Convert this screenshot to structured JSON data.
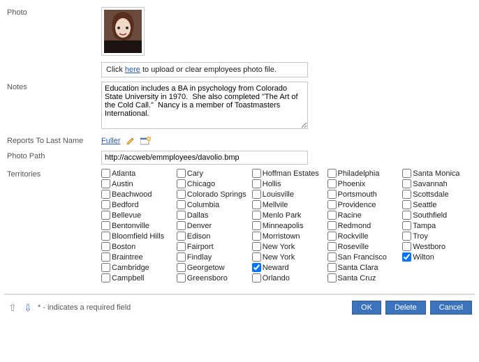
{
  "labels": {
    "photo": "Photo",
    "notes": "Notes",
    "reports_to_last_name": "Reports To Last Name",
    "photo_path": "Photo Path",
    "territories": "Territories"
  },
  "upload_hint": {
    "prefix": "Click ",
    "link": "here",
    "suffix": " to upload or clear employees photo file."
  },
  "notes_value": "Education includes a BA in psychology from Colorado State University in 1970.  She also completed \"The Art of the Cold Call.\"  Nancy is a member of Toastmasters International.",
  "reports_to": {
    "value": "Fuller"
  },
  "photo_path_value": "http://accweb/emmployees/davolio.bmp",
  "territories": [
    {
      "label": "Atlanta",
      "checked": false
    },
    {
      "label": "Austin",
      "checked": false
    },
    {
      "label": "Beachwood",
      "checked": false
    },
    {
      "label": "Bedford",
      "checked": false
    },
    {
      "label": "Bellevue",
      "checked": false
    },
    {
      "label": "Bentonville",
      "checked": false
    },
    {
      "label": "Bloomfield Hills",
      "checked": false
    },
    {
      "label": "Boston",
      "checked": false
    },
    {
      "label": "Braintree",
      "checked": false
    },
    {
      "label": "Cambridge",
      "checked": false
    },
    {
      "label": "Campbell",
      "checked": false
    },
    {
      "label": "Cary",
      "checked": false
    },
    {
      "label": "Chicago",
      "checked": false
    },
    {
      "label": "Colorado Springs",
      "checked": false
    },
    {
      "label": "Columbia",
      "checked": false
    },
    {
      "label": "Dallas",
      "checked": false
    },
    {
      "label": "Denver",
      "checked": false
    },
    {
      "label": "Edison",
      "checked": false
    },
    {
      "label": "Fairport",
      "checked": false
    },
    {
      "label": "Findlay",
      "checked": false
    },
    {
      "label": "Georgetow",
      "checked": false
    },
    {
      "label": "Greensboro",
      "checked": false
    },
    {
      "label": "Hoffman Estates",
      "checked": false
    },
    {
      "label": "Hollis",
      "checked": false
    },
    {
      "label": "Louisville",
      "checked": false
    },
    {
      "label": "Mellvile",
      "checked": false
    },
    {
      "label": "Menlo Park",
      "checked": false
    },
    {
      "label": "Minneapolis",
      "checked": false
    },
    {
      "label": "Morristown",
      "checked": false
    },
    {
      "label": "New York",
      "checked": false
    },
    {
      "label": "New York",
      "checked": false
    },
    {
      "label": "Neward",
      "checked": true
    },
    {
      "label": "Orlando",
      "checked": false
    },
    {
      "label": "Philadelphia",
      "checked": false
    },
    {
      "label": "Phoenix",
      "checked": false
    },
    {
      "label": "Portsmouth",
      "checked": false
    },
    {
      "label": "Providence",
      "checked": false
    },
    {
      "label": "Racine",
      "checked": false
    },
    {
      "label": "Redmond",
      "checked": false
    },
    {
      "label": "Rockville",
      "checked": false
    },
    {
      "label": "Roseville",
      "checked": false
    },
    {
      "label": "San Francisco",
      "checked": false
    },
    {
      "label": "Santa Clara",
      "checked": false
    },
    {
      "label": "Santa Cruz",
      "checked": false
    },
    {
      "label": "Santa Monica",
      "checked": false
    },
    {
      "label": "Savannah",
      "checked": false
    },
    {
      "label": "Scottsdale",
      "checked": false
    },
    {
      "label": "Seattle",
      "checked": false
    },
    {
      "label": "Southfield",
      "checked": false
    },
    {
      "label": "Tampa",
      "checked": false
    },
    {
      "label": "Troy",
      "checked": false
    },
    {
      "label": "Westboro",
      "checked": false
    },
    {
      "label": "Wilton",
      "checked": true
    }
  ],
  "footer": {
    "required_note": "* - indicates a required field",
    "ok": "OK",
    "delete": "Delete",
    "cancel": "Cancel"
  }
}
